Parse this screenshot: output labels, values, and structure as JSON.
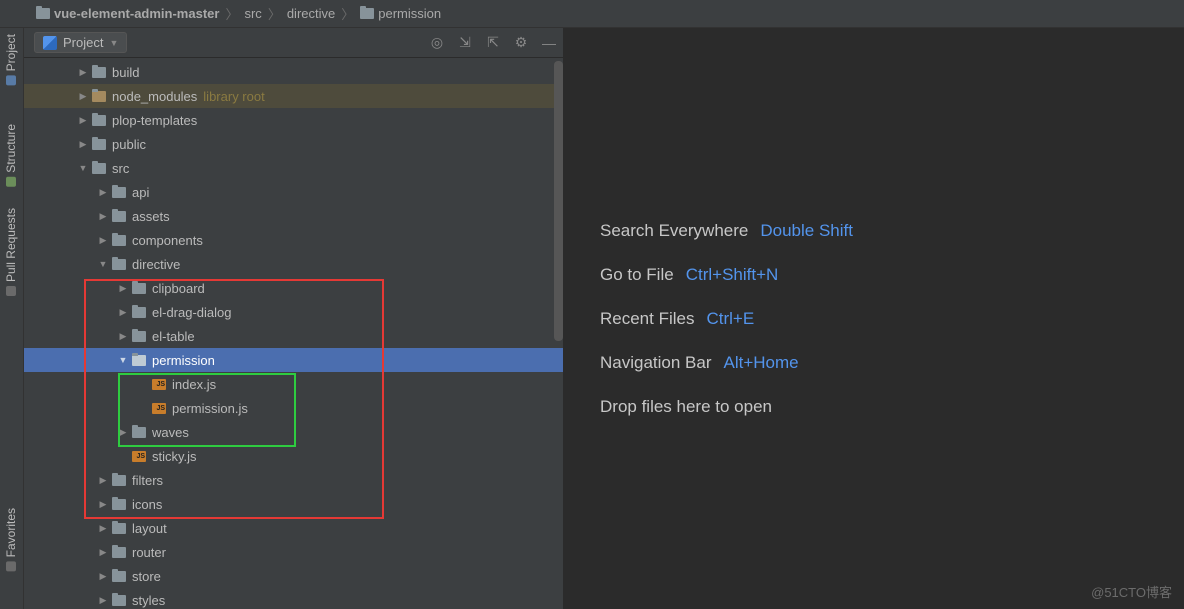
{
  "breadcrumb": {
    "root": "vue-element-admin-master",
    "p1": "src",
    "p2": "directive",
    "p3": "permission"
  },
  "edgeTabs": {
    "project": "Project",
    "structure": "Structure",
    "pull": "Pull Requests",
    "fav": "Favorites"
  },
  "sidebar": {
    "title": "Project"
  },
  "tree": {
    "build": "build",
    "node_modules": "node_modules",
    "node_modules_hint": "library root",
    "plop": "plop-templates",
    "public": "public",
    "src": "src",
    "api": "api",
    "assets": "assets",
    "components": "components",
    "directive": "directive",
    "clipboard": "clipboard",
    "eldrag": "el-drag-dialog",
    "eltable": "el-table",
    "permission": "permission",
    "indexjs": "index.js",
    "permjs": "permission.js",
    "waves": "waves",
    "sticky": "sticky.js",
    "filters": "filters",
    "icons": "icons",
    "layout": "layout",
    "router": "router",
    "store": "store",
    "styles": "styles"
  },
  "editor": {
    "search": "Search Everywhere",
    "search_key": "Double Shift",
    "goto": "Go to File",
    "goto_key": "Ctrl+Shift+N",
    "recent": "Recent Files",
    "recent_key": "Ctrl+E",
    "nav": "Navigation Bar",
    "nav_key": "Alt+Home",
    "drop": "Drop files here to open"
  },
  "watermark": "@51CTO博客"
}
